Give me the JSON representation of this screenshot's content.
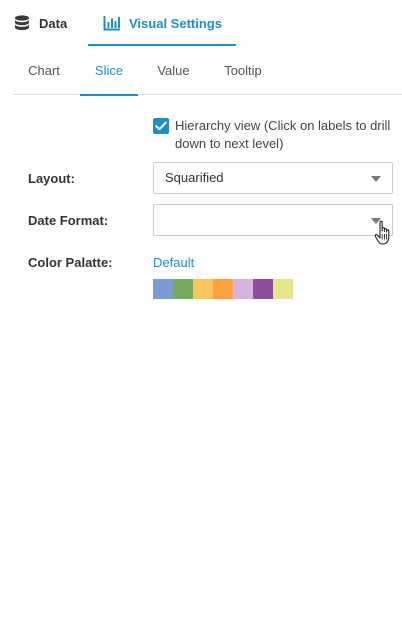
{
  "top_tabs": {
    "data_label": "Data",
    "visual_label": "Visual Settings",
    "active": "visual"
  },
  "sub_tabs": [
    {
      "label": "Chart",
      "active": false
    },
    {
      "label": "Slice",
      "active": true
    },
    {
      "label": "Value",
      "active": false
    },
    {
      "label": "Tooltip",
      "active": false
    }
  ],
  "hierarchy": {
    "checked": true,
    "label": "Hierarchy view (Click on labels to drill down to next level)"
  },
  "layout": {
    "label": "Layout:",
    "value": "Squarified"
  },
  "date_format": {
    "label": "Date Format:",
    "value": ""
  },
  "color_palette": {
    "label": "Color Palatte:",
    "name": "Default",
    "colors": [
      "#7b9bd1",
      "#72aa5e",
      "#fac55a",
      "#fba13e",
      "#d7b3df",
      "#8d4d9f",
      "#e5e68b"
    ]
  },
  "theme": {
    "accent": "#1e8fc6"
  },
  "icons": {
    "data": "database-icon",
    "visual": "bar-chart-icon",
    "check": "checkmark-icon",
    "caret": "caret-down-icon",
    "cursor": "hand-pointer-icon"
  }
}
